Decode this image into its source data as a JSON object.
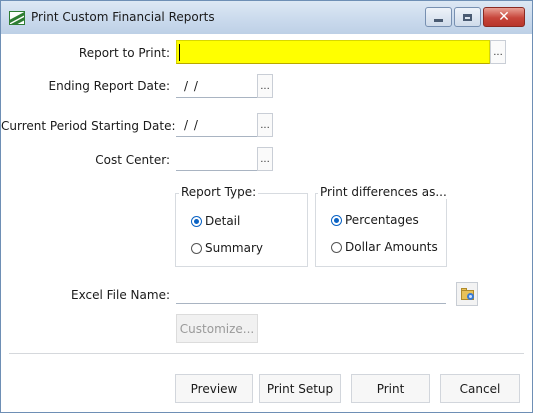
{
  "window": {
    "title": "Print Custom Financial Reports",
    "icon": "app-logo-icon",
    "controls": {
      "minimize": "minimize-icon",
      "maximize": "maximize-icon",
      "close": "✕"
    }
  },
  "form": {
    "report_to_print": {
      "label": "Report to Print:",
      "value": "",
      "browse": "..."
    },
    "ending_report_date": {
      "label": "Ending Report Date:",
      "value": "/ /",
      "browse": "..."
    },
    "current_period_start": {
      "label": "Current Period Starting Date:",
      "value": "/ /",
      "browse": "..."
    },
    "cost_center": {
      "label": "Cost Center:",
      "value": "",
      "browse": "..."
    },
    "report_type": {
      "title": "Report Type:",
      "options": [
        {
          "label": "Detail",
          "selected": true
        },
        {
          "label": "Summary",
          "selected": false
        }
      ]
    },
    "print_differences": {
      "title": "Print differences as...",
      "options": [
        {
          "label": "Percentages",
          "selected": true
        },
        {
          "label": "Dollar Amounts",
          "selected": false
        }
      ]
    },
    "excel_file_name": {
      "label": "Excel File Name:",
      "value": "",
      "browse_icon": "folder-search-icon"
    },
    "customize": {
      "label": "Customize...",
      "enabled": false
    }
  },
  "footer": {
    "preview": "Preview",
    "print_setup": "Print Setup",
    "print": "Print",
    "cancel": "Cancel"
  },
  "colors": {
    "highlight_field": "#ffff00",
    "radio_accent": "#0b63c4",
    "close_button": "#c7453a",
    "titlebar": "#c9d9ec"
  }
}
